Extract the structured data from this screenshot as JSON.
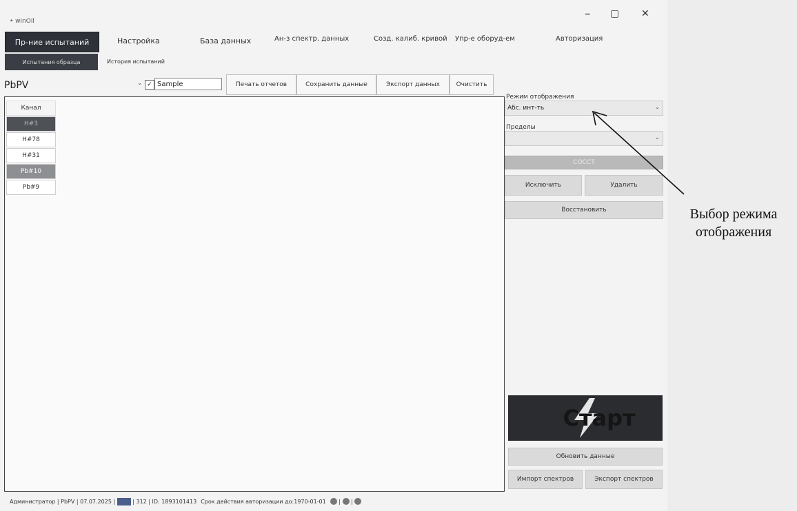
{
  "window": {
    "title": "winOil"
  },
  "window_controls": {
    "minimize": "–",
    "maximize": "▢",
    "close": "✕"
  },
  "menu": {
    "tests_button": "Пр-ние испытаний",
    "items": [
      "Настройка",
      "База данных",
      "Ан-з спектр. данных",
      "Созд. калиб. кривой",
      "Упр-е оборуд-ем",
      "Авторизация"
    ],
    "sub_button": "Испытания образца",
    "history": "История испытаний"
  },
  "toolbar": {
    "product_select": "PbPV",
    "sample_checkbox_checked": true,
    "sample_value": "Sample",
    "print_reports": "Печать отчетов",
    "save_data": "Сохранить данные",
    "export_data": "Экспорт данных",
    "clear": "Очистить"
  },
  "channels": {
    "header": "Канал",
    "items": [
      "H#3",
      "H#78",
      "H#31",
      "Pb#10",
      "Pb#9"
    ]
  },
  "right_panel": {
    "display_mode_label": "Режим отображения",
    "display_mode_value": "Абс. инт-ть",
    "limits_label": "Пределы",
    "limits_value": "",
    "gray_bar_label": "COCCT",
    "exclude": "Исключить",
    "delete": "Удалить",
    "restore": "Восстановить",
    "start": "Старт",
    "refresh": "Обновить данные",
    "import_spectra": "Импорт спектров",
    "export_spectra": "Экспорт спектров"
  },
  "status": {
    "user": "Администратор",
    "product": "PbPV",
    "date": "07.07.2025",
    "count": "312",
    "id": "ID: 1893101413",
    "auth": "Срок действия авторизации до:1970-01-01"
  },
  "annotation": {
    "text_line1": "Выбор режима",
    "text_line2": "отображения"
  },
  "colors": {
    "dark": "#2e3138",
    "selected": "#4e5156",
    "selected_alt": "#8d8f93"
  }
}
